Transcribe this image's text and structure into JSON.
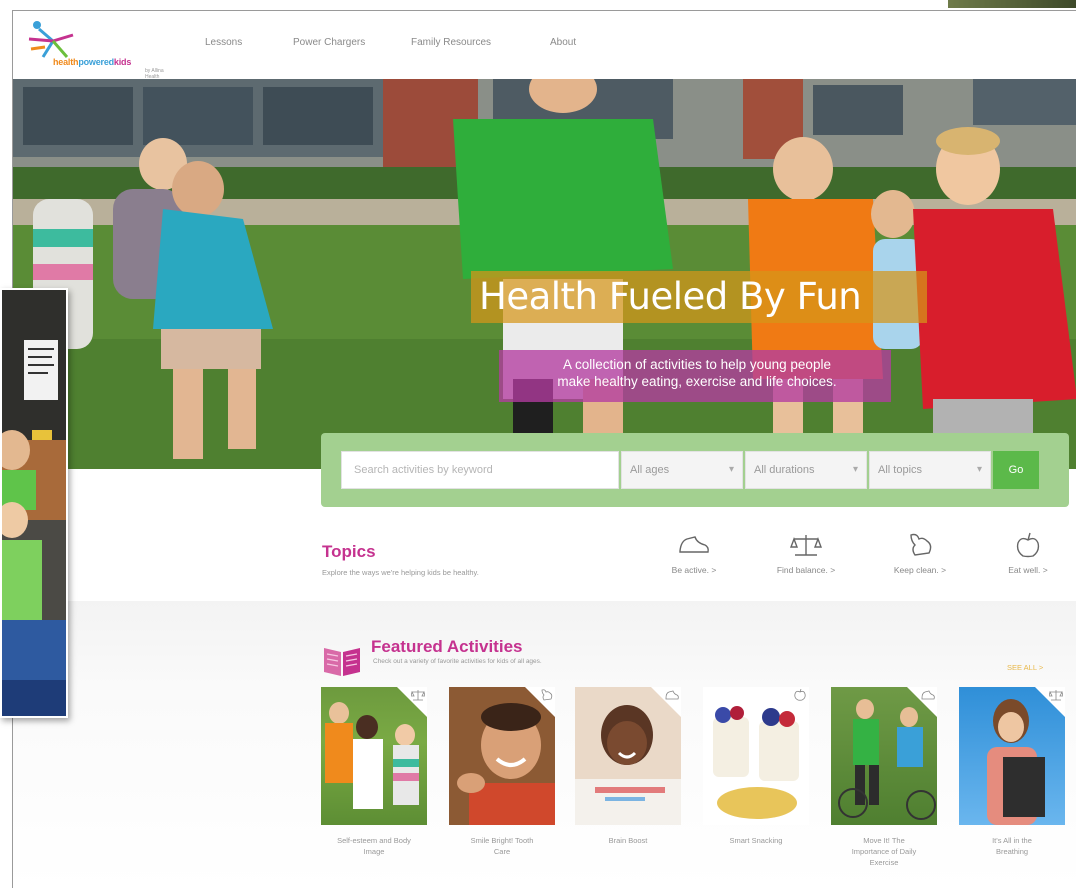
{
  "brand": {
    "logo_text_a": "health",
    "logo_text_b": "powered",
    "logo_text_c": "kids",
    "logo_sub": "by Allina Health"
  },
  "nav": {
    "items": [
      "Lessons",
      "Power Chargers",
      "Family Resources",
      "About"
    ]
  },
  "hero": {
    "title": "Health Fueled By Fun",
    "subtitle_line1": "A collection of activities to help young people",
    "subtitle_line2": "make healthy eating, exercise and life choices."
  },
  "search": {
    "placeholder": "Search activities by keyword",
    "ages": "All ages",
    "durations": "All durations",
    "topics": "All topics",
    "go": "Go"
  },
  "topics": {
    "title": "Topics",
    "subtitle": "Explore the ways we're helping kids be healthy.",
    "items": [
      {
        "label": "Be active. >",
        "icon": "sneaker-icon"
      },
      {
        "label": "Find balance. >",
        "icon": "scale-icon"
      },
      {
        "label": "Keep clean. >",
        "icon": "muscle-arm-icon"
      },
      {
        "label": "Eat well. >",
        "icon": "apple-icon"
      }
    ]
  },
  "featured": {
    "title": "Featured Activities",
    "subtitle": "Check out a variety of favorite activities for kids of all ages.",
    "see_all": "SEE ALL >",
    "cards": [
      {
        "caption_l1": "Self-esteem and Body",
        "caption_l2": "Image",
        "caption_l3": "",
        "icon": "scale-icon"
      },
      {
        "caption_l1": "Smile Bright! Tooth",
        "caption_l2": "Care",
        "caption_l3": "",
        "icon": "muscle-arm-icon"
      },
      {
        "caption_l1": "Brain Boost",
        "caption_l2": "",
        "caption_l3": "",
        "icon": "sneaker-icon"
      },
      {
        "caption_l1": "Smart Snacking",
        "caption_l2": "",
        "caption_l3": "",
        "icon": "apple-icon"
      },
      {
        "caption_l1": "Move It! The",
        "caption_l2": "Importance of Daily",
        "caption_l3": "Exercise",
        "icon": "sneaker-icon"
      },
      {
        "caption_l1": "It's All in the",
        "caption_l2": "Breathing",
        "caption_l3": "",
        "icon": "scale-icon"
      }
    ]
  },
  "colors": {
    "accent_pink": "#c5328f",
    "go_green": "#5cb94a",
    "search_band": "#a3d090",
    "title_orange": "#d6961a",
    "sub_magenta": "#b43ca0"
  }
}
